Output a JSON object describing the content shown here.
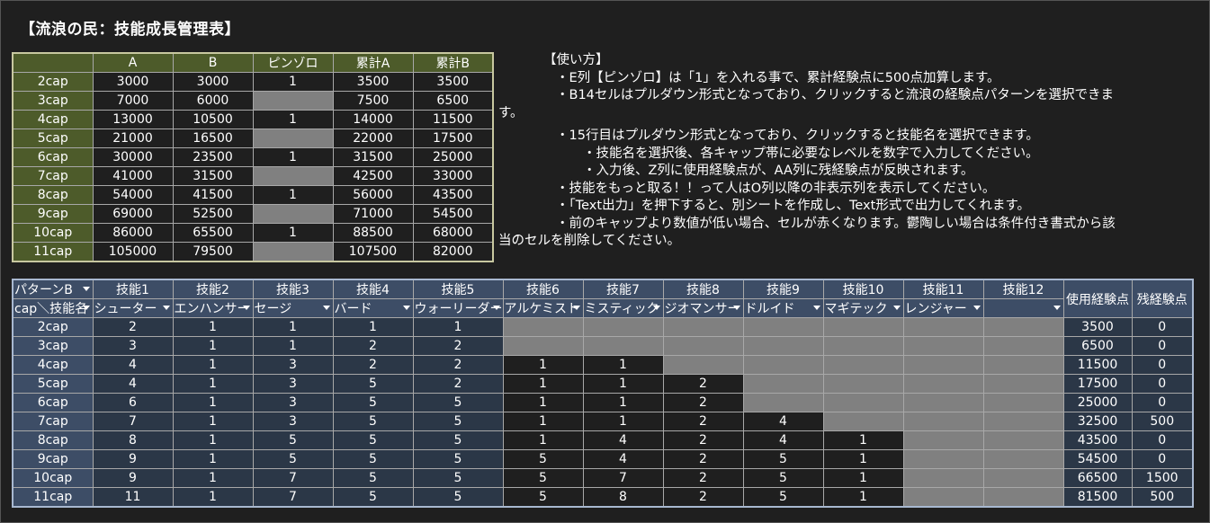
{
  "title": "【流浪の民：技能成長管理表】",
  "top_table": {
    "headers": [
      "",
      "A",
      "B",
      "ピンゾロ",
      "累計A",
      "累計B"
    ],
    "rows": [
      {
        "cap": "2cap",
        "a": "3000",
        "b": "3000",
        "pin": "1",
        "ra": "3500",
        "rb": "3500"
      },
      {
        "cap": "3cap",
        "a": "7000",
        "b": "6000",
        "pin": "",
        "ra": "7500",
        "rb": "6500"
      },
      {
        "cap": "4cap",
        "a": "13000",
        "b": "10500",
        "pin": "1",
        "ra": "14000",
        "rb": "11500"
      },
      {
        "cap": "5cap",
        "a": "21000",
        "b": "16500",
        "pin": "",
        "ra": "22000",
        "rb": "17500"
      },
      {
        "cap": "6cap",
        "a": "30000",
        "b": "23500",
        "pin": "1",
        "ra": "31500",
        "rb": "25000"
      },
      {
        "cap": "7cap",
        "a": "41000",
        "b": "31500",
        "pin": "",
        "ra": "42500",
        "rb": "33000"
      },
      {
        "cap": "8cap",
        "a": "54000",
        "b": "41500",
        "pin": "1",
        "ra": "56000",
        "rb": "43500"
      },
      {
        "cap": "9cap",
        "a": "69000",
        "b": "52500",
        "pin": "",
        "ra": "71000",
        "rb": "54500"
      },
      {
        "cap": "10cap",
        "a": "86000",
        "b": "65500",
        "pin": "1",
        "ra": "88500",
        "rb": "68000"
      },
      {
        "cap": "11cap",
        "a": "105000",
        "b": "79500",
        "pin": "",
        "ra": "107500",
        "rb": "82000"
      }
    ]
  },
  "instructions": {
    "heading": "【使い方】",
    "l1": "・E列【ピンゾロ】は「1」を入れる事で、累計経験点に500点加算します。",
    "l2a": "・B14セルはプルダウン形式となっており、クリックすると流浪の経験点パターンを選択できま",
    "l2b": "す。",
    "l3": "・15行目はプルダウン形式となっており、クリックすると技能名を選択できます。",
    "l4": "・技能名を選択後、各キャップ帯に必要なレベルを数字で入力してください。",
    "l5": "・入力後、Z列に使用経験点が、AA列に残経験点が反映されます。",
    "l6": "・技能をもっと取る！！って人はO列以降の非表示列を表示してください。",
    "l7": "・「Text出力」を押下すると、別シートを作成し、Text形式で出力してくれます。",
    "l8a": "・前のキャップより数値が低い場合、セルが赤くなります。鬱陶しい場合は条件付き書式から該",
    "l8b": "当のセルを削除してください。"
  },
  "bottom_table": {
    "pattern_label": "パターンB",
    "skill_headers": [
      "技能1",
      "技能2",
      "技能3",
      "技能4",
      "技能5",
      "技能6",
      "技能7",
      "技能8",
      "技能9",
      "技能10",
      "技能11",
      "技能12"
    ],
    "used_header": "使用経験点",
    "remain_header": "残経験点",
    "cap_label": "cap＼技能名",
    "skill_names": [
      "シューター",
      "エンハンサー",
      "セージ",
      "バード",
      "ウォーリーダー",
      "アルケミスト",
      "ミスティック",
      "ジオマンサー",
      "ドルイド",
      "マギテック",
      "レンジャー",
      ""
    ],
    "rows": [
      {
        "cap": "2cap",
        "v": [
          "2",
          "1",
          "1",
          "1",
          "1",
          "",
          "",
          "",
          "",
          "",
          "",
          ""
        ],
        "used": "3500",
        "remain": "0"
      },
      {
        "cap": "3cap",
        "v": [
          "3",
          "1",
          "1",
          "2",
          "2",
          "",
          "",
          "",
          "",
          "",
          "",
          ""
        ],
        "used": "6500",
        "remain": "0"
      },
      {
        "cap": "4cap",
        "v": [
          "4",
          "1",
          "3",
          "2",
          "2",
          "1",
          "1",
          "",
          "",
          "",
          "",
          ""
        ],
        "used": "11500",
        "remain": "0"
      },
      {
        "cap": "5cap",
        "v": [
          "4",
          "1",
          "3",
          "5",
          "2",
          "1",
          "1",
          "2",
          "",
          "",
          "",
          ""
        ],
        "used": "17500",
        "remain": "0"
      },
      {
        "cap": "6cap",
        "v": [
          "6",
          "1",
          "3",
          "5",
          "5",
          "1",
          "1",
          "2",
          "",
          "",
          "",
          ""
        ],
        "used": "25000",
        "remain": "0"
      },
      {
        "cap": "7cap",
        "v": [
          "7",
          "1",
          "3",
          "5",
          "5",
          "1",
          "1",
          "2",
          "4",
          "",
          "",
          ""
        ],
        "used": "32500",
        "remain": "500"
      },
      {
        "cap": "8cap",
        "v": [
          "8",
          "1",
          "5",
          "5",
          "5",
          "1",
          "4",
          "2",
          "4",
          "1",
          "",
          ""
        ],
        "used": "43500",
        "remain": "0"
      },
      {
        "cap": "9cap",
        "v": [
          "9",
          "1",
          "5",
          "5",
          "5",
          "5",
          "4",
          "2",
          "5",
          "1",
          "",
          ""
        ],
        "used": "54500",
        "remain": "0"
      },
      {
        "cap": "10cap",
        "v": [
          "9",
          "1",
          "7",
          "5",
          "5",
          "5",
          "7",
          "2",
          "5",
          "1",
          "",
          ""
        ],
        "used": "66500",
        "remain": "1500"
      },
      {
        "cap": "11cap",
        "v": [
          "11",
          "1",
          "7",
          "5",
          "5",
          "5",
          "8",
          "2",
          "5",
          "1",
          "",
          ""
        ],
        "used": "81500",
        "remain": "500"
      }
    ]
  }
}
